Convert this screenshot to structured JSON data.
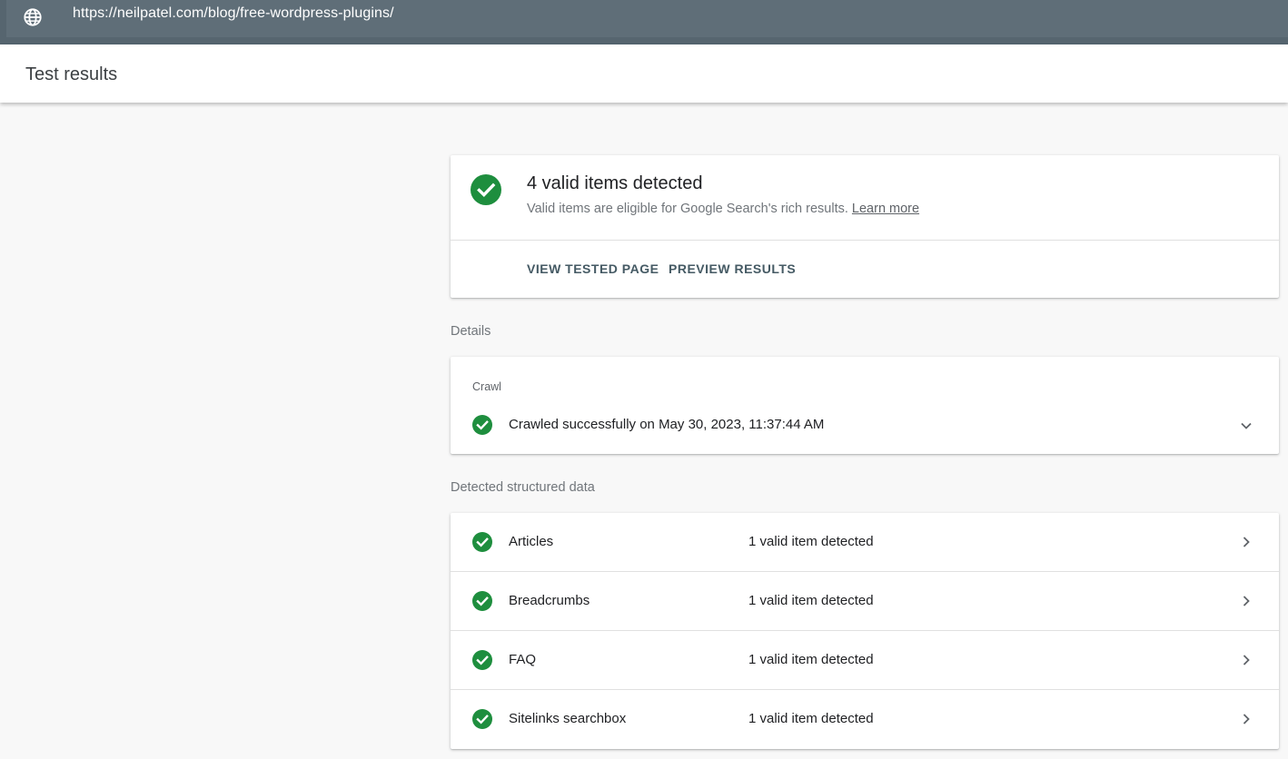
{
  "url_bar": {
    "icon": "globe-icon",
    "url": "https://neilpatel.com/blog/free-wordpress-plugins/"
  },
  "header": {
    "title": "Test results"
  },
  "summary": {
    "title": "4 valid items detected",
    "subtitle": "Valid items are eligible for Google Search's rich results.",
    "learn_more": "Learn more",
    "view_tested_page": "VIEW TESTED PAGE",
    "preview_results": "PREVIEW RESULTS"
  },
  "details": {
    "label": "Details",
    "crawl": {
      "label": "Crawl",
      "status": "Crawled successfully on May 30, 2023, 11:37:44 AM"
    }
  },
  "structured": {
    "label": "Detected structured data",
    "rows": [
      {
        "name": "Articles",
        "status": "1 valid item detected"
      },
      {
        "name": "Breadcrumbs",
        "status": "1 valid item detected"
      },
      {
        "name": "FAQ",
        "status": "1 valid item detected"
      },
      {
        "name": "Sitelinks searchbox",
        "status": "1 valid item detected"
      }
    ]
  },
  "colors": {
    "valid_green": "#1e8e3e",
    "url_bar": "#5f6e78",
    "action_text": "#455a64"
  }
}
